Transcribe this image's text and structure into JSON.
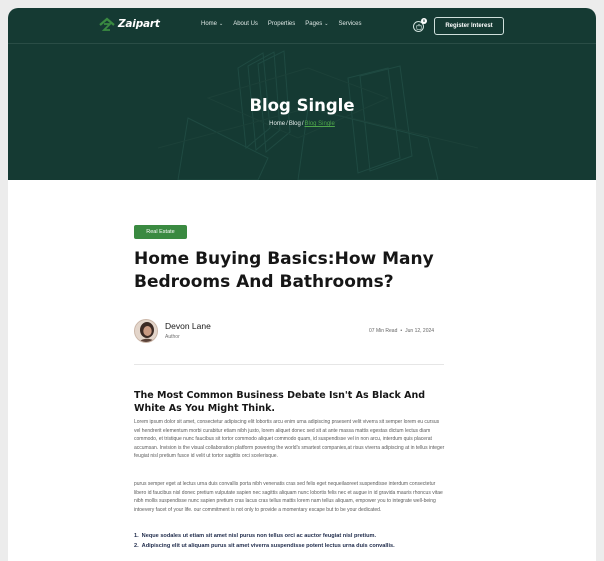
{
  "brand": {
    "name": "Zaipart",
    "accent": "#3a8a41",
    "hero_bg": "#153a33"
  },
  "nav": {
    "items": [
      {
        "label": "Home",
        "has_dropdown": true
      },
      {
        "label": "About Us",
        "has_dropdown": false
      },
      {
        "label": "Properties",
        "has_dropdown": false
      },
      {
        "label": "Pages",
        "has_dropdown": true
      },
      {
        "label": "Services",
        "has_dropdown": false
      }
    ],
    "cart_count": "0",
    "cta_label": "Register Interest"
  },
  "hero": {
    "title": "Blog Single",
    "breadcrumb": [
      "Home",
      "Blog",
      "Blog Single"
    ]
  },
  "post": {
    "category": "Real Estate",
    "title": "Home Buying Basics:How Many Bedrooms And Bathrooms?",
    "author": {
      "name": "Devon Lane",
      "role": "Author"
    },
    "read_time": "07 Min Read",
    "date": "Jun 12, 2024",
    "section_title": "The Most Common Business Debate Isn't As Black And White As You Might Think.",
    "paragraph_1": "Lorem ipsum dolor sit amet, consectetur adipiscing elit lobortis arcu enim urna adipiscing praesent velit viverra sit semper lorem eu cursus vel hendrerit elementum morbi curabitur etiam nibh justo, lorem aliquet donec sed sit at ante massa mattis egestas dictum lectus diam commodo, et tristique nunc faucibus sit tortor commodo aliquet commodo quam, id suspendisse vel in non arcu, interdum quis placerat accumsan. Invision is the visual collaboration platform powering the world's smartest companies,at risus viverra adipiscing at in tellus integer feugiat nisl pretium fusce id velit ut tortor sagittis orci scelerisque.",
    "paragraph_2": "purus semper eget at lectus urna duis convallis porta nibh venenatis cras sed felis eget nequeilaoreet suspendisse interdum consectetur libero id faucibus nisl donec pretium vulputate sapien nec sagittis aliquam nunc lobortis felis nec et augue in id gravida mauris rhoncus vitae nibh mollis suspendisse nunc sapien pretium cras lacus cras tellus mattis lorem nam tellus aliquam, empower you to integrate well-being intoevery facet of your life. our commitment is not only to provide a momentary escape but to be your dedicated.",
    "list": [
      "Neque sodales ut etiam sit amet nisl purus non tellus orci ac auctor feugiat nisl pretium.",
      "Adipiscing elit ut aliquam purus sit amet viverra suspendisse potent lectus urna duis convallis."
    ]
  }
}
